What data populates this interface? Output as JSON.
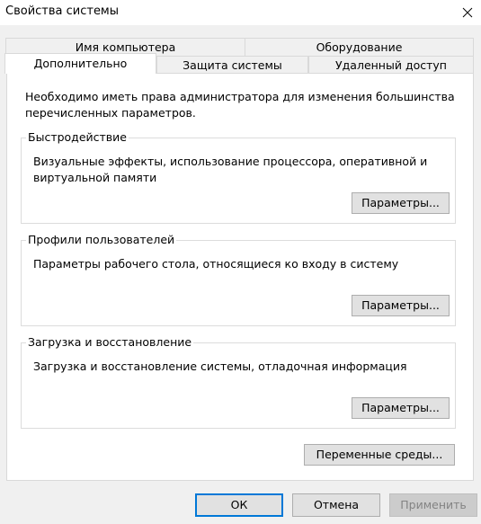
{
  "window": {
    "title": "Свойства системы"
  },
  "icons": {
    "close": "close-icon"
  },
  "tabs": {
    "row_back": [
      {
        "label": "Имя компьютера"
      },
      {
        "label": "Оборудование"
      }
    ],
    "row_front": [
      {
        "label": "Дополнительно",
        "active": true
      },
      {
        "label": "Защита системы"
      },
      {
        "label": "Удаленный доступ"
      }
    ]
  },
  "panel": {
    "intro": "Необходимо иметь права администратора для изменения большинства перечисленных параметров.",
    "performance": {
      "legend": "Быстродействие",
      "text": "Визуальные эффекты, использование процессора, оперативной и виртуальной памяти",
      "button": "Параметры..."
    },
    "profiles": {
      "legend": "Профили пользователей",
      "text": "Параметры рабочего стола, относящиеся ко входу в систему",
      "button": "Параметры..."
    },
    "startup": {
      "legend": "Загрузка и восстановление",
      "text": "Загрузка и восстановление системы, отладочная информация",
      "button": "Параметры..."
    },
    "env_button": "Переменные среды..."
  },
  "footer": {
    "ok": "ОК",
    "cancel": "Отмена",
    "apply": "Применить"
  },
  "colors": {
    "focus_border": "#0078d7",
    "panel_bg": "#ffffff",
    "window_bg": "#f0f0f0"
  }
}
